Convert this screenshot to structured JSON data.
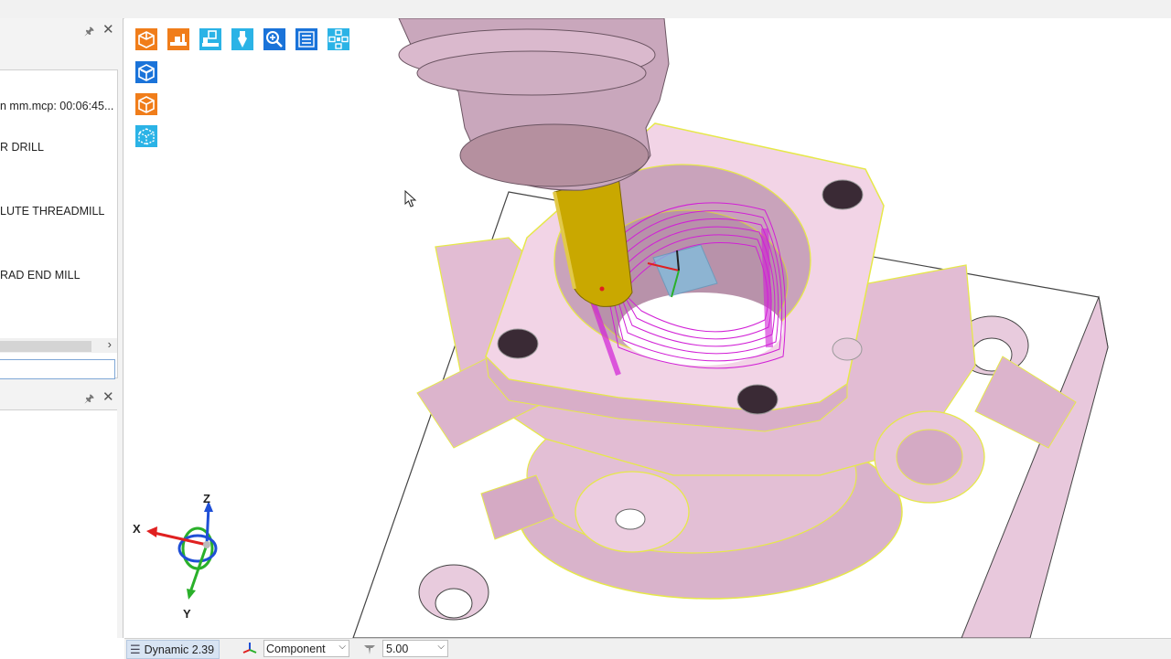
{
  "ops_panel": {
    "items": [
      {
        "label": "n mm.mcp: 00:06:45..."
      },
      {
        "label": "R DRILL"
      },
      {
        "label": "LUTE THREADMILL"
      },
      {
        "label": "RAD END MILL"
      }
    ]
  },
  "icons": {
    "pin": "pin-icon",
    "close": "close-icon",
    "scroll_right": "chevron-right-icon"
  },
  "toolbar": {
    "buttons": [
      {
        "name": "stock-model-button",
        "color": "#f07d1a"
      },
      {
        "name": "machine-button",
        "color": "#f07d1a"
      },
      {
        "name": "machine-sim-button",
        "color": "#2bb3e6"
      },
      {
        "name": "tool-button",
        "color": "#2bb3e6"
      },
      {
        "name": "zoom-button",
        "color": "#1a73d9"
      },
      {
        "name": "list-button",
        "color": "#1a73d9"
      },
      {
        "name": "axes-button",
        "color": "#2bb3e6"
      },
      {
        "name": "view-workpiece-button",
        "color": "#1a73d9"
      },
      {
        "name": "view-stock-button",
        "color": "#f07d1a"
      },
      {
        "name": "view-transparent-button",
        "color": "#2bb3e6"
      }
    ]
  },
  "gnomon": {
    "x": "X",
    "y": "Y",
    "z": "Z"
  },
  "status": {
    "dynamic": "Dynamic 2.39",
    "component": "Component",
    "value": "5.00"
  },
  "colors": {
    "part": "#e9c6dc",
    "edge": "#e6e84a",
    "toolpath": "#d11fd6",
    "tool_holder": "#c8a7bb",
    "tool": "#c9a800"
  }
}
